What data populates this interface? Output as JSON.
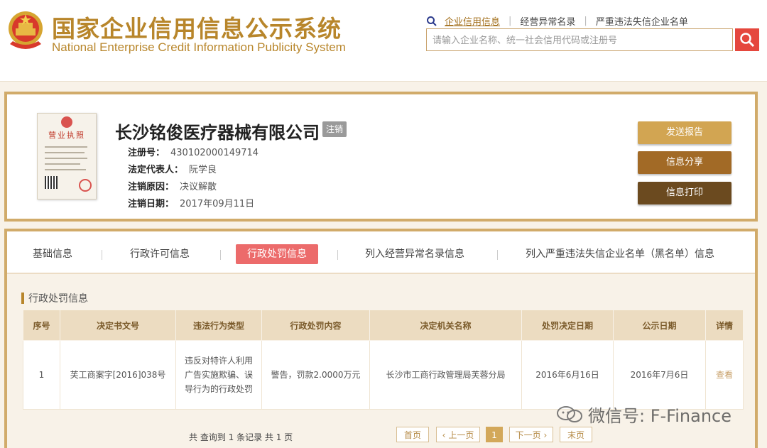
{
  "header": {
    "logo_cn": "国家企业信用信息公示系统",
    "logo_en": "National Enterprise Credit Information Publicity System",
    "links": [
      "企业信用信息",
      "经营异常名录",
      "严重违法失信企业名单"
    ],
    "search_placeholder": "请输入企业名称、统一社会信用代码或注册号"
  },
  "company": {
    "name": "长沙铭俊医疗器械有限公司",
    "status": "注销",
    "license_title": "营业执照",
    "fields": [
      {
        "label": "注册号：",
        "value": "430102000149714"
      },
      {
        "label": "法定代表人：",
        "value": "阮学良"
      },
      {
        "label": "注销原因：",
        "value": "决议解散"
      },
      {
        "label": "注销日期：",
        "value": "2017年09月11日"
      }
    ],
    "buttons": [
      "发送报告",
      "信息分享",
      "信息打印"
    ]
  },
  "tabs": [
    "基础信息",
    "行政许可信息",
    "行政处罚信息",
    "列入经营异常名录信息",
    "列入严重违法失信企业名单（黑名单）信息"
  ],
  "active_tab": "行政处罚信息",
  "section_title": "行政处罚信息",
  "table": {
    "headers": [
      "序号",
      "决定书文号",
      "违法行为类型",
      "行政处罚内容",
      "决定机关名称",
      "处罚决定日期",
      "公示日期",
      "详情"
    ],
    "rows": [
      [
        "1",
        "芙工商案字[2016]038号",
        "违反对特许人利用广告实施欺骗、误导行为的行政处罚",
        "警告，罚款2.0000万元",
        "长沙市工商行政管理局芙蓉分局",
        "2016年6月16日",
        "2016年7月6日",
        "查看"
      ]
    ]
  },
  "pager": {
    "info": "共 查询到 1 条记录 共 1 页",
    "first": "首页",
    "prev": "上一页",
    "current": "1",
    "next": "下一页",
    "last": "末页"
  },
  "watermark": "微信号: F-Finance",
  "colors": {
    "gold": "#b8862b",
    "accent_red": "#ec6b6b",
    "search_red": "#e5473d",
    "border_gold": "#d1ab6a"
  }
}
